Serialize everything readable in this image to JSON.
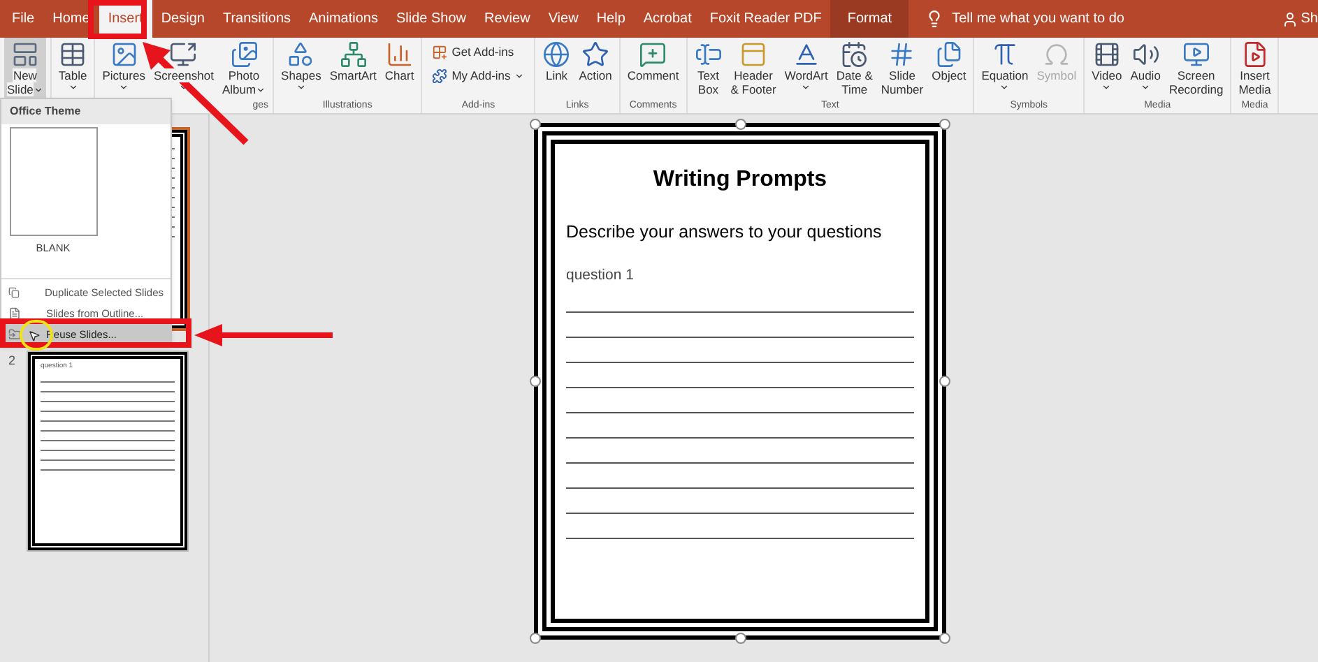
{
  "tabs": [
    {
      "label": "File",
      "selected": false,
      "kind": "normal"
    },
    {
      "label": "Home",
      "selected": false,
      "kind": "normal"
    },
    {
      "label": "Insert",
      "selected": true,
      "kind": "normal"
    },
    {
      "label": "Design",
      "selected": false,
      "kind": "normal"
    },
    {
      "label": "Transitions",
      "selected": false,
      "kind": "normal"
    },
    {
      "label": "Animations",
      "selected": false,
      "kind": "normal"
    },
    {
      "label": "Slide Show",
      "selected": false,
      "kind": "normal"
    },
    {
      "label": "Review",
      "selected": false,
      "kind": "normal"
    },
    {
      "label": "View",
      "selected": false,
      "kind": "normal"
    },
    {
      "label": "Help",
      "selected": false,
      "kind": "normal"
    },
    {
      "label": "Acrobat",
      "selected": false,
      "kind": "normal"
    },
    {
      "label": "Foxit Reader PDF",
      "selected": false,
      "kind": "normal"
    },
    {
      "label": "Format",
      "selected": false,
      "kind": "contextual"
    }
  ],
  "tell_me": {
    "placeholder": "Tell me what you want to do"
  },
  "share": "Sh",
  "ribbon": {
    "groups": [
      {
        "buttons": [
          {
            "lines": [
              "New",
              "Slide"
            ],
            "dropdown": true,
            "pressed": true,
            "disabled": false
          }
        ]
      },
      {
        "buttons": [
          {
            "lines": [
              "Table"
            ],
            "dropdown": true,
            "pressed": false,
            "disabled": false
          }
        ]
      },
      {
        "label": "ges",
        "buttons": [
          {
            "lines": [
              "Pictures"
            ],
            "dropdown": true,
            "pressed": false,
            "disabled": false
          },
          {
            "lines": [
              "Screenshot"
            ],
            "dropdown": true,
            "pressed": false,
            "disabled": false
          },
          {
            "lines": [
              "Photo",
              "Album"
            ],
            "dropdown": true,
            "pressed": false,
            "disabled": false
          }
        ]
      },
      {
        "label": "Illustrations",
        "buttons": [
          {
            "lines": [
              "Shapes"
            ],
            "dropdown": true,
            "pressed": false,
            "disabled": false
          },
          {
            "lines": [
              "SmartArt"
            ],
            "dropdown": false,
            "pressed": false,
            "disabled": false
          },
          {
            "lines": [
              "Chart"
            ],
            "dropdown": false,
            "pressed": false,
            "disabled": false
          }
        ]
      },
      {
        "label": "Add-ins",
        "kind": "small",
        "buttons": [
          {
            "lines": [
              "Get Add-ins"
            ],
            "dropdown": false,
            "pressed": false,
            "disabled": false
          },
          {
            "lines": [
              "My Add-ins"
            ],
            "dropdown": true,
            "pressed": false,
            "disabled": false
          }
        ]
      },
      {
        "label": "Links",
        "buttons": [
          {
            "lines": [
              "Link"
            ],
            "dropdown": false,
            "pressed": false,
            "disabled": false
          },
          {
            "lines": [
              "Action"
            ],
            "dropdown": false,
            "pressed": false,
            "disabled": false
          }
        ]
      },
      {
        "label": "Comments",
        "buttons": [
          {
            "lines": [
              "Comment"
            ],
            "dropdown": false,
            "pressed": false,
            "disabled": false
          }
        ]
      },
      {
        "label": "Text",
        "buttons": [
          {
            "lines": [
              "Text",
              "Box"
            ],
            "dropdown": false,
            "pressed": false,
            "disabled": false
          },
          {
            "lines": [
              "Header",
              "& Footer"
            ],
            "dropdown": false,
            "pressed": false,
            "disabled": false
          },
          {
            "lines": [
              "WordArt"
            ],
            "dropdown": true,
            "pressed": false,
            "disabled": false
          },
          {
            "lines": [
              "Date &",
              "Time"
            ],
            "dropdown": false,
            "pressed": false,
            "disabled": false
          },
          {
            "lines": [
              "Slide",
              "Number"
            ],
            "dropdown": false,
            "pressed": false,
            "disabled": false
          },
          {
            "lines": [
              "Object"
            ],
            "dropdown": false,
            "pressed": false,
            "disabled": false
          }
        ]
      },
      {
        "label": "Symbols",
        "buttons": [
          {
            "lines": [
              "Equation"
            ],
            "dropdown": true,
            "pressed": false,
            "disabled": false
          },
          {
            "lines": [
              "Symbol"
            ],
            "dropdown": false,
            "pressed": false,
            "disabled": true
          }
        ]
      },
      {
        "label": "Media",
        "buttons": [
          {
            "lines": [
              "Video"
            ],
            "dropdown": true,
            "pressed": false,
            "disabled": false
          },
          {
            "lines": [
              "Audio"
            ],
            "dropdown": true,
            "pressed": false,
            "disabled": false
          },
          {
            "lines": [
              "Screen",
              "Recording"
            ],
            "dropdown": false,
            "pressed": false,
            "disabled": false
          }
        ]
      },
      {
        "label": "Media",
        "buttons": [
          {
            "lines": [
              "Insert",
              "Media"
            ],
            "dropdown": false,
            "pressed": false,
            "disabled": false
          }
        ]
      }
    ]
  },
  "new_slide_menu": {
    "header": "Office Theme",
    "layouts": [
      {
        "label": "BLANK"
      }
    ],
    "items": [
      {
        "label": "Duplicate Selected Slides",
        "highlighted": false
      },
      {
        "label": "Slides from Outline...",
        "highlighted": false
      },
      {
        "label": "Reuse Slides...",
        "highlighted": true
      }
    ]
  },
  "thumbnails": [
    {
      "selected": true
    },
    {
      "number": "2",
      "selected": false,
      "text": "question 1"
    }
  ],
  "slide": {
    "title": "Writing Prompts",
    "subtitle": "Describe your answers to your questions",
    "question": "question 1"
  }
}
